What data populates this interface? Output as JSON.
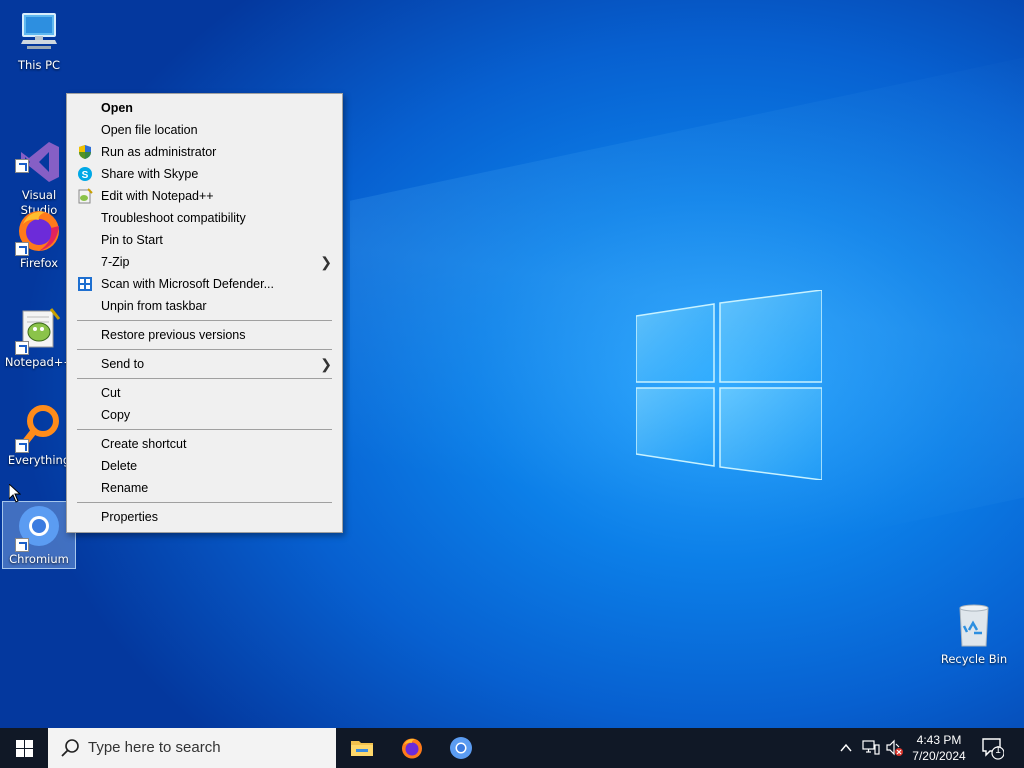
{
  "desktop": {
    "icons": [
      {
        "label": "This PC"
      },
      {
        "label": "Visual Studio\n2017"
      },
      {
        "label": "Firefox"
      },
      {
        "label": "Notepad++"
      },
      {
        "label": "Everything"
      },
      {
        "label": "Chromium"
      },
      {
        "label": "Recycle Bin"
      }
    ]
  },
  "context_menu": {
    "items": [
      {
        "label": "Open",
        "bold": true
      },
      {
        "label": "Open file location"
      },
      {
        "label": "Run as administrator",
        "icon": "uac-shield-icon"
      },
      {
        "label": "Share with Skype",
        "icon": "skype-icon"
      },
      {
        "label": "Edit with Notepad++",
        "icon": "notepad-plus-plus-icon"
      },
      {
        "label": "Troubleshoot compatibility"
      },
      {
        "label": "Pin to Start"
      },
      {
        "label": "7-Zip",
        "submenu": true
      },
      {
        "label": "Scan with Microsoft Defender...",
        "icon": "defender-icon"
      },
      {
        "label": "Unpin from taskbar"
      },
      {
        "label": "Restore previous versions"
      },
      {
        "label": "Send to",
        "submenu": true
      },
      {
        "label": "Cut"
      },
      {
        "label": "Copy"
      },
      {
        "label": "Create shortcut"
      },
      {
        "label": "Delete"
      },
      {
        "label": "Rename"
      },
      {
        "label": "Properties"
      }
    ]
  },
  "taskbar": {
    "search_placeholder": "Type here to search",
    "pinned": [
      "file-explorer-icon",
      "firefox-icon",
      "chromium-icon"
    ],
    "clock_time": "4:43 PM",
    "clock_date": "7/20/2024",
    "notification_count": "1"
  },
  "colors": {
    "accent": "#0c7fe8",
    "taskbar": "#101826",
    "menu_bg": "#f0f0f0"
  }
}
